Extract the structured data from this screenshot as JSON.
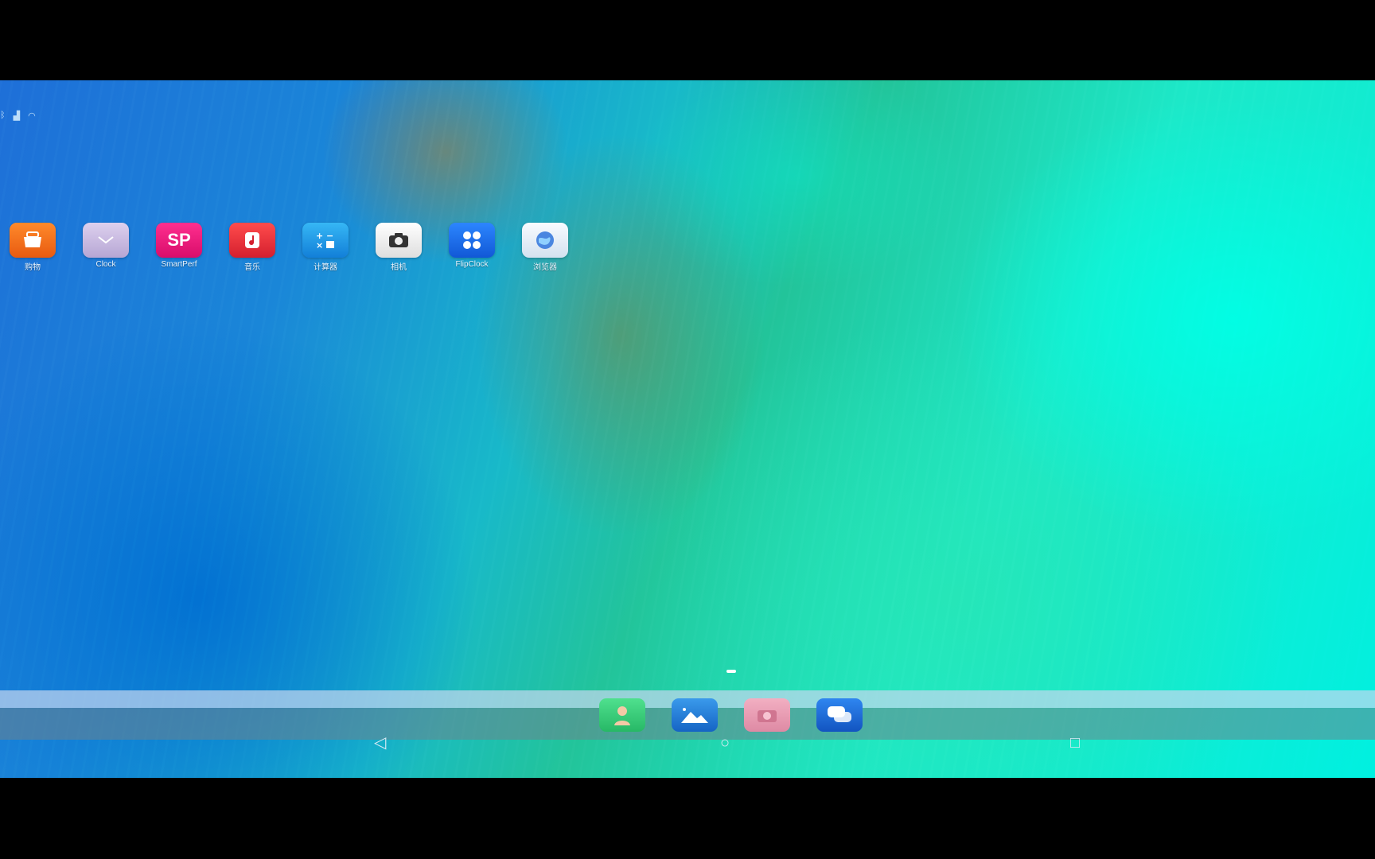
{
  "status_bar": {
    "icons": [
      "bluetooth-icon",
      "signal-icon",
      "wifi-icon"
    ]
  },
  "apps": [
    {
      "name": "shop-app",
      "label": "购物",
      "icon": "basket-icon",
      "color": "#f26a1b"
    },
    {
      "name": "clock-app",
      "label": "Clock",
      "icon": "clock-icon",
      "color": "#c9b9e0"
    },
    {
      "name": "smartperf-app",
      "label": "SmartPerf",
      "icon_text": "SP",
      "color": "#e8197a"
    },
    {
      "name": "music-app",
      "label": "音乐",
      "icon": "music-note-icon",
      "color": "#e8303a"
    },
    {
      "name": "calculator-app",
      "label": "计算器",
      "icon": "calculator-icon",
      "color": "#1e9ee8"
    },
    {
      "name": "camera-app",
      "label": "相机",
      "icon": "camera-icon",
      "color": "#eeeeee"
    },
    {
      "name": "flipclock-app",
      "label": "FlipClock",
      "icon": "grid-icon",
      "color": "#1a6ee6"
    },
    {
      "name": "browser-app",
      "label": "浏览器",
      "icon": "globe-icon",
      "color": "#e6eef6"
    }
  ],
  "dock": [
    {
      "name": "contacts-dock-icon",
      "icon": "person-icon",
      "color": "#3ad07a"
    },
    {
      "name": "gallery-dock-icon",
      "icon": "mountain-icon",
      "color": "#1e7fd6"
    },
    {
      "name": "camera-dock-icon",
      "icon": "camera-icon",
      "color": "#e89ab0"
    },
    {
      "name": "messages-dock-icon",
      "icon": "chat-icon",
      "color": "#1a6fd8"
    }
  ],
  "nav": {
    "back": "◁",
    "home": "○",
    "recent": "□"
  }
}
